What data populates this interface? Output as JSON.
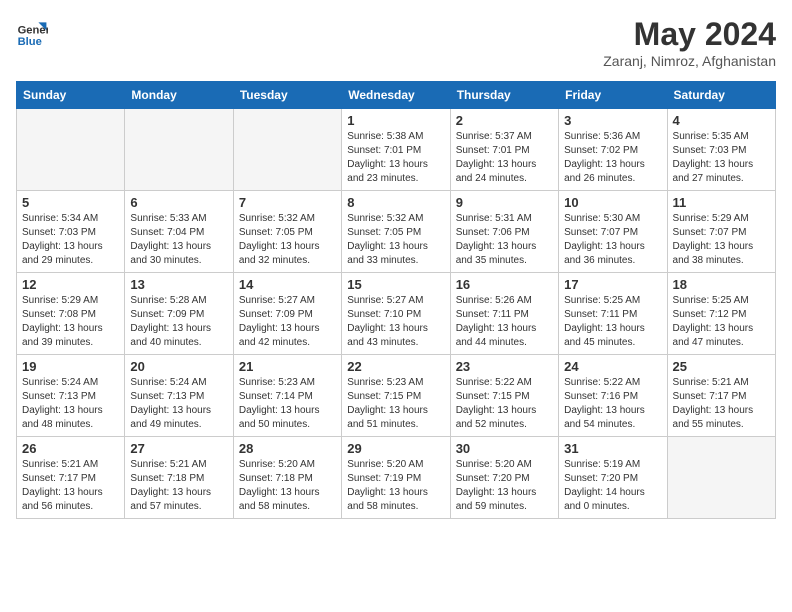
{
  "header": {
    "logo_line1": "General",
    "logo_line2": "Blue",
    "month_year": "May 2024",
    "location": "Zaranj, Nimroz, Afghanistan"
  },
  "weekdays": [
    "Sunday",
    "Monday",
    "Tuesday",
    "Wednesday",
    "Thursday",
    "Friday",
    "Saturday"
  ],
  "weeks": [
    [
      {
        "day": "",
        "sunrise": "",
        "sunset": "",
        "daylight": ""
      },
      {
        "day": "",
        "sunrise": "",
        "sunset": "",
        "daylight": ""
      },
      {
        "day": "",
        "sunrise": "",
        "sunset": "",
        "daylight": ""
      },
      {
        "day": "1",
        "sunrise": "Sunrise: 5:38 AM",
        "sunset": "Sunset: 7:01 PM",
        "daylight": "Daylight: 13 hours and 23 minutes."
      },
      {
        "day": "2",
        "sunrise": "Sunrise: 5:37 AM",
        "sunset": "Sunset: 7:01 PM",
        "daylight": "Daylight: 13 hours and 24 minutes."
      },
      {
        "day": "3",
        "sunrise": "Sunrise: 5:36 AM",
        "sunset": "Sunset: 7:02 PM",
        "daylight": "Daylight: 13 hours and 26 minutes."
      },
      {
        "day": "4",
        "sunrise": "Sunrise: 5:35 AM",
        "sunset": "Sunset: 7:03 PM",
        "daylight": "Daylight: 13 hours and 27 minutes."
      }
    ],
    [
      {
        "day": "5",
        "sunrise": "Sunrise: 5:34 AM",
        "sunset": "Sunset: 7:03 PM",
        "daylight": "Daylight: 13 hours and 29 minutes."
      },
      {
        "day": "6",
        "sunrise": "Sunrise: 5:33 AM",
        "sunset": "Sunset: 7:04 PM",
        "daylight": "Daylight: 13 hours and 30 minutes."
      },
      {
        "day": "7",
        "sunrise": "Sunrise: 5:32 AM",
        "sunset": "Sunset: 7:05 PM",
        "daylight": "Daylight: 13 hours and 32 minutes."
      },
      {
        "day": "8",
        "sunrise": "Sunrise: 5:32 AM",
        "sunset": "Sunset: 7:05 PM",
        "daylight": "Daylight: 13 hours and 33 minutes."
      },
      {
        "day": "9",
        "sunrise": "Sunrise: 5:31 AM",
        "sunset": "Sunset: 7:06 PM",
        "daylight": "Daylight: 13 hours and 35 minutes."
      },
      {
        "day": "10",
        "sunrise": "Sunrise: 5:30 AM",
        "sunset": "Sunset: 7:07 PM",
        "daylight": "Daylight: 13 hours and 36 minutes."
      },
      {
        "day": "11",
        "sunrise": "Sunrise: 5:29 AM",
        "sunset": "Sunset: 7:07 PM",
        "daylight": "Daylight: 13 hours and 38 minutes."
      }
    ],
    [
      {
        "day": "12",
        "sunrise": "Sunrise: 5:29 AM",
        "sunset": "Sunset: 7:08 PM",
        "daylight": "Daylight: 13 hours and 39 minutes."
      },
      {
        "day": "13",
        "sunrise": "Sunrise: 5:28 AM",
        "sunset": "Sunset: 7:09 PM",
        "daylight": "Daylight: 13 hours and 40 minutes."
      },
      {
        "day": "14",
        "sunrise": "Sunrise: 5:27 AM",
        "sunset": "Sunset: 7:09 PM",
        "daylight": "Daylight: 13 hours and 42 minutes."
      },
      {
        "day": "15",
        "sunrise": "Sunrise: 5:27 AM",
        "sunset": "Sunset: 7:10 PM",
        "daylight": "Daylight: 13 hours and 43 minutes."
      },
      {
        "day": "16",
        "sunrise": "Sunrise: 5:26 AM",
        "sunset": "Sunset: 7:11 PM",
        "daylight": "Daylight: 13 hours and 44 minutes."
      },
      {
        "day": "17",
        "sunrise": "Sunrise: 5:25 AM",
        "sunset": "Sunset: 7:11 PM",
        "daylight": "Daylight: 13 hours and 45 minutes."
      },
      {
        "day": "18",
        "sunrise": "Sunrise: 5:25 AM",
        "sunset": "Sunset: 7:12 PM",
        "daylight": "Daylight: 13 hours and 47 minutes."
      }
    ],
    [
      {
        "day": "19",
        "sunrise": "Sunrise: 5:24 AM",
        "sunset": "Sunset: 7:13 PM",
        "daylight": "Daylight: 13 hours and 48 minutes."
      },
      {
        "day": "20",
        "sunrise": "Sunrise: 5:24 AM",
        "sunset": "Sunset: 7:13 PM",
        "daylight": "Daylight: 13 hours and 49 minutes."
      },
      {
        "day": "21",
        "sunrise": "Sunrise: 5:23 AM",
        "sunset": "Sunset: 7:14 PM",
        "daylight": "Daylight: 13 hours and 50 minutes."
      },
      {
        "day": "22",
        "sunrise": "Sunrise: 5:23 AM",
        "sunset": "Sunset: 7:15 PM",
        "daylight": "Daylight: 13 hours and 51 minutes."
      },
      {
        "day": "23",
        "sunrise": "Sunrise: 5:22 AM",
        "sunset": "Sunset: 7:15 PM",
        "daylight": "Daylight: 13 hours and 52 minutes."
      },
      {
        "day": "24",
        "sunrise": "Sunrise: 5:22 AM",
        "sunset": "Sunset: 7:16 PM",
        "daylight": "Daylight: 13 hours and 54 minutes."
      },
      {
        "day": "25",
        "sunrise": "Sunrise: 5:21 AM",
        "sunset": "Sunset: 7:17 PM",
        "daylight": "Daylight: 13 hours and 55 minutes."
      }
    ],
    [
      {
        "day": "26",
        "sunrise": "Sunrise: 5:21 AM",
        "sunset": "Sunset: 7:17 PM",
        "daylight": "Daylight: 13 hours and 56 minutes."
      },
      {
        "day": "27",
        "sunrise": "Sunrise: 5:21 AM",
        "sunset": "Sunset: 7:18 PM",
        "daylight": "Daylight: 13 hours and 57 minutes."
      },
      {
        "day": "28",
        "sunrise": "Sunrise: 5:20 AM",
        "sunset": "Sunset: 7:18 PM",
        "daylight": "Daylight: 13 hours and 58 minutes."
      },
      {
        "day": "29",
        "sunrise": "Sunrise: 5:20 AM",
        "sunset": "Sunset: 7:19 PM",
        "daylight": "Daylight: 13 hours and 58 minutes."
      },
      {
        "day": "30",
        "sunrise": "Sunrise: 5:20 AM",
        "sunset": "Sunset: 7:20 PM",
        "daylight": "Daylight: 13 hours and 59 minutes."
      },
      {
        "day": "31",
        "sunrise": "Sunrise: 5:19 AM",
        "sunset": "Sunset: 7:20 PM",
        "daylight": "Daylight: 14 hours and 0 minutes."
      },
      {
        "day": "",
        "sunrise": "",
        "sunset": "",
        "daylight": ""
      }
    ]
  ]
}
